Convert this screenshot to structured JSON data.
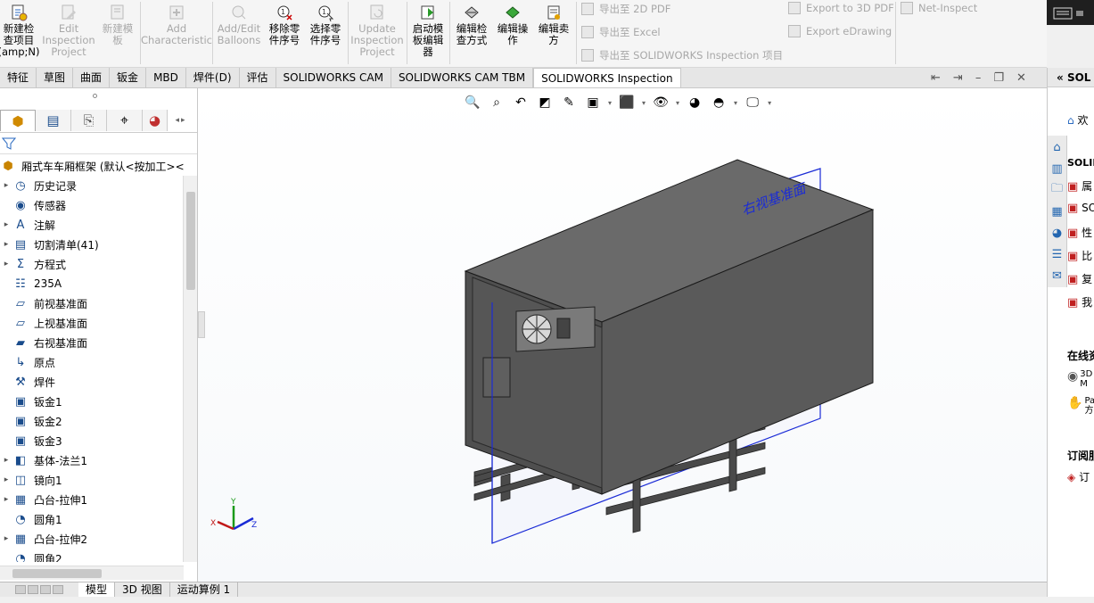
{
  "ribbon": {
    "buttons": [
      {
        "label": "新建检\n查项目\n(amp;N)",
        "disabled": false,
        "icon": "new-inspection-icon"
      },
      {
        "label": "Edit\nInspection\nProject",
        "disabled": true,
        "icon": "edit-inspection-icon"
      },
      {
        "label": "新建模\n板",
        "disabled": true,
        "icon": "new-template-icon"
      },
      {
        "label": "Add\nCharacteristic",
        "disabled": true,
        "icon": "add-characteristic-icon"
      },
      {
        "label": "Add/Edit\nBalloons",
        "disabled": true,
        "icon": "balloons-icon"
      },
      {
        "label": "移除零\n件序号",
        "disabled": false,
        "icon": "remove-balloon-icon"
      },
      {
        "label": "选择零\n件序号",
        "disabled": false,
        "icon": "select-balloon-icon"
      },
      {
        "label": "Update\nInspection\nProject",
        "disabled": true,
        "icon": "update-project-icon"
      },
      {
        "label": "启动模\n板编辑\n器",
        "disabled": false,
        "icon": "template-editor-icon"
      },
      {
        "label": "编辑检\n查方式",
        "disabled": false,
        "icon": "edit-method-icon"
      },
      {
        "label": "编辑操\n作",
        "disabled": false,
        "icon": "edit-operation-icon"
      },
      {
        "label": "编辑卖\n方",
        "disabled": false,
        "icon": "edit-vendor-icon"
      }
    ],
    "export_list_1": [
      "导出至 2D PDF",
      "导出至 Excel",
      "导出至 SOLIDWORKS Inspection 项目"
    ],
    "export_list_2": [
      "Export to 3D PDF",
      "Export eDrawing"
    ],
    "net_inspect": "Net-Inspect"
  },
  "tabs": [
    "特征",
    "草图",
    "曲面",
    "钣金",
    "MBD",
    "焊件(D)",
    "评估",
    "SOLIDWORKS CAM",
    "SOLIDWORKS CAM TBM",
    "SOLIDWORKS Inspection"
  ],
  "active_tab": "SOLIDWORKS Inspection",
  "tree": {
    "root": "厢式车车厢框架  (默认<按加工><",
    "items": [
      {
        "label": "历史记录",
        "expand": true,
        "icon": "history-icon",
        "glyph": "◷"
      },
      {
        "label": "传感器",
        "expand": false,
        "icon": "sensor-icon",
        "glyph": "◉"
      },
      {
        "label": "注解",
        "expand": true,
        "icon": "annotation-icon",
        "glyph": "A"
      },
      {
        "label": "切割清单(41)",
        "expand": true,
        "icon": "cutlist-icon",
        "glyph": "▤"
      },
      {
        "label": "方程式",
        "expand": true,
        "icon": "equation-icon",
        "glyph": "Σ"
      },
      {
        "label": "235A",
        "expand": false,
        "icon": "material-icon",
        "glyph": "☷"
      },
      {
        "label": "前视基准面",
        "expand": false,
        "icon": "plane-icon",
        "glyph": "▱"
      },
      {
        "label": "上视基准面",
        "expand": false,
        "icon": "plane-icon",
        "glyph": "▱"
      },
      {
        "label": "右视基准面",
        "expand": false,
        "icon": "plane-icon",
        "glyph": "▰"
      },
      {
        "label": "原点",
        "expand": false,
        "icon": "origin-icon",
        "glyph": "↳"
      },
      {
        "label": "焊件",
        "expand": false,
        "icon": "weldment-icon",
        "glyph": "⚒"
      },
      {
        "label": "钣金1",
        "expand": false,
        "icon": "sheetmetal-icon",
        "glyph": "▣"
      },
      {
        "label": "钣金2",
        "expand": false,
        "icon": "sheetmetal-icon",
        "glyph": "▣"
      },
      {
        "label": "钣金3",
        "expand": false,
        "icon": "sheetmetal-icon",
        "glyph": "▣"
      },
      {
        "label": "基体-法兰1",
        "expand": true,
        "icon": "base-flange-icon",
        "glyph": "◧"
      },
      {
        "label": "镜向1",
        "expand": true,
        "icon": "mirror-icon",
        "glyph": "◫"
      },
      {
        "label": "凸台-拉伸1",
        "expand": true,
        "icon": "boss-extrude-icon",
        "glyph": "▦"
      },
      {
        "label": "圆角1",
        "expand": false,
        "icon": "fillet-icon",
        "glyph": "◔"
      },
      {
        "label": "凸台-拉伸2",
        "expand": true,
        "icon": "boss-extrude-icon",
        "glyph": "▦"
      },
      {
        "label": "圆角2",
        "expand": false,
        "icon": "fillet-icon",
        "glyph": "◔"
      }
    ]
  },
  "viewport": {
    "plane_label": "右视基准面",
    "triad": {
      "x": "X",
      "y": "Y",
      "z": "Z"
    },
    "plane_color": "#1a2bd6",
    "body_color": "#5a5a5a"
  },
  "right_panel": {
    "header": "SOL",
    "welcome": "欢",
    "section1": "SOLID",
    "items1": [
      "属",
      "SO",
      "性",
      "比",
      "复",
      "我"
    ],
    "section2": "在线资",
    "items2a": [
      "3D",
      "M"
    ],
    "items2b": [
      "Pa",
      "方"
    ],
    "section3": "订阅服",
    "items3": [
      "订"
    ]
  },
  "bottom_tabs": [
    "模型",
    "3D 视图",
    "运动算例 1"
  ],
  "active_bottom_tab": "模型"
}
